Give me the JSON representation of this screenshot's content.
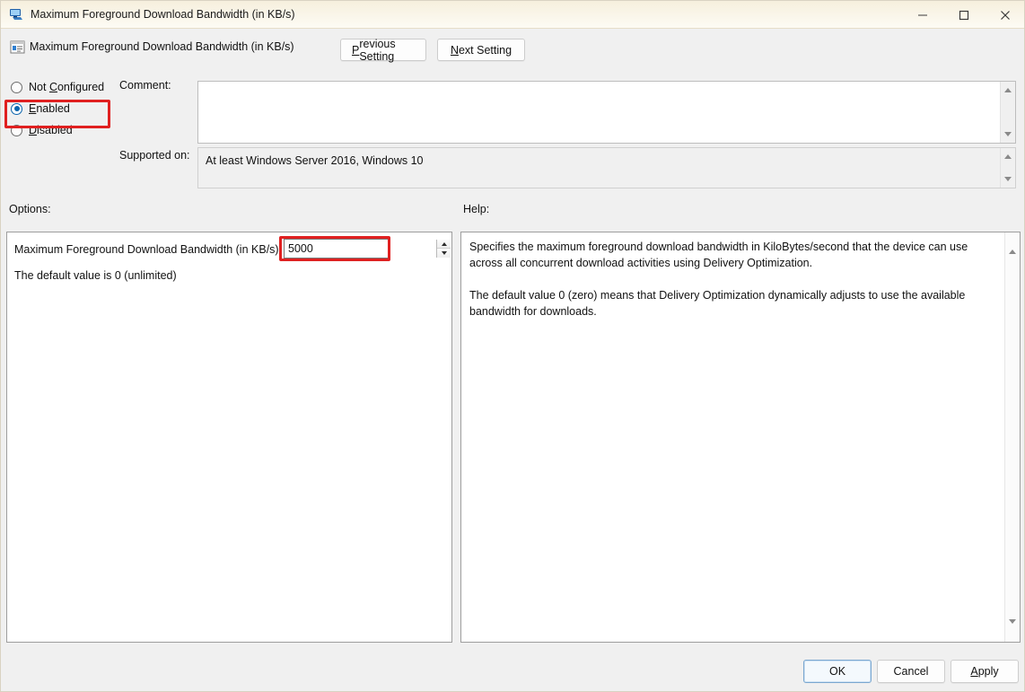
{
  "window": {
    "title": "Maximum Foreground Download Bandwidth (in KB/s)",
    "icon": "computer-monitor-icon",
    "minimize_label": "—",
    "maximize_label": "☐",
    "close_label": "✕"
  },
  "header": {
    "icon": "policy-setting-icon",
    "setting_title": "Maximum Foreground Download Bandwidth (in KB/s)",
    "previous_accel": "P",
    "previous_rest": "revious Setting",
    "next_accel": "N",
    "next_rest": "ext Setting"
  },
  "states": {
    "not_configured": {
      "pre": "Not ",
      "accel": "C",
      "post": "onfigured",
      "selected": false
    },
    "enabled": {
      "pre": "",
      "accel": "E",
      "post": "nabled",
      "selected": true
    },
    "disabled": {
      "pre": "",
      "accel": "D",
      "post": "isabled",
      "selected": false
    },
    "selected_value": "Enabled",
    "highlight_color": "#e02020"
  },
  "comment": {
    "label": "Comment:",
    "value": "",
    "placeholder": ""
  },
  "supported_on": {
    "label": "Supported on:",
    "value": "At least Windows Server 2016, Windows 10"
  },
  "options": {
    "section_label": "Options:",
    "field_label": "Maximum Foreground Download Bandwidth (in KB/s):",
    "field_value": "5000",
    "note": "The default value is 0 (unlimited)"
  },
  "help": {
    "section_label": "Help:",
    "paragraphs": [
      "Specifies the maximum foreground download bandwidth in KiloBytes/second that the device can use across all concurrent download activities using Delivery Optimization.",
      "The default value 0 (zero) means that Delivery Optimization dynamically adjusts to use the available bandwidth for downloads."
    ]
  },
  "footer": {
    "ok": "OK",
    "cancel": "Cancel",
    "apply_accel": "A",
    "apply_rest": "pply"
  }
}
